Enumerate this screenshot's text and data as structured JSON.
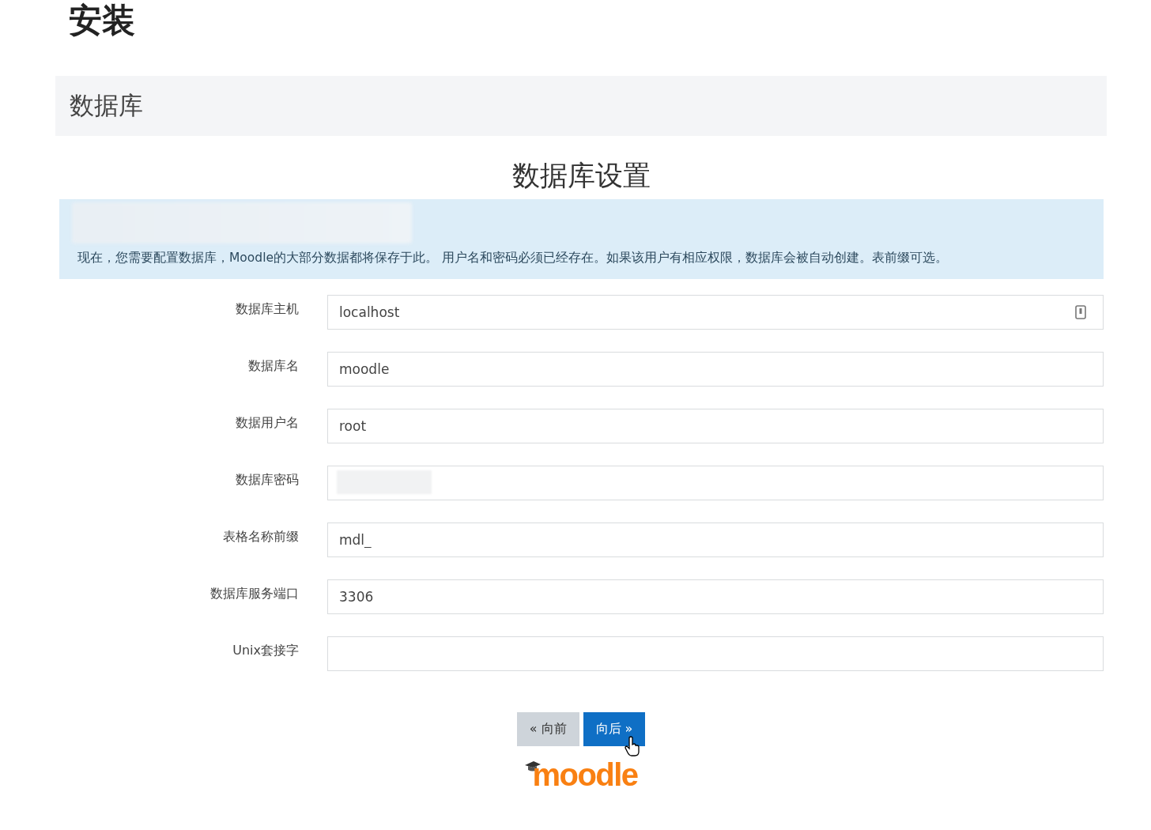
{
  "page_title": "安装",
  "section": {
    "title": "数据库"
  },
  "form": {
    "title": "数据库设置",
    "notice": "现在，您需要配置数据库，Moodle的大部分数据都将保存于此。 用户名和密码必须已经存在。如果该用户有相应权限，数据库会被自动创建。表前缀可选。",
    "fields": [
      {
        "label": "数据库主机",
        "value": "localhost",
        "kind": "text"
      },
      {
        "label": "数据库名",
        "value": "moodle",
        "kind": "text"
      },
      {
        "label": "数据用户名",
        "value": "root",
        "kind": "text"
      },
      {
        "label": "数据库密码",
        "kind": "password"
      },
      {
        "label": "表格名称前缀",
        "value": "mdl_",
        "kind": "text"
      },
      {
        "label": "数据库服务端口",
        "value": "3306",
        "kind": "text"
      },
      {
        "label": "Unix套接字",
        "kind": "text"
      }
    ]
  },
  "buttons": [
    {
      "label": "« 向前",
      "kind": "secondary"
    },
    {
      "label": "向后 »",
      "kind": "primary"
    }
  ],
  "logo": {
    "text": "moodle"
  }
}
